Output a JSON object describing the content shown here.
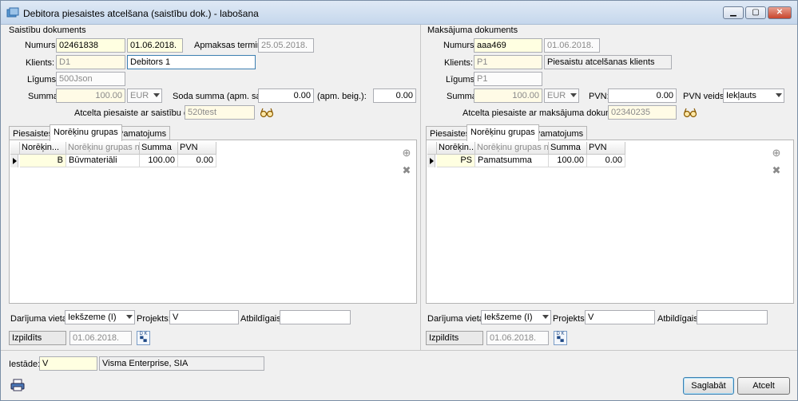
{
  "window": {
    "title": "Debitora piesaistes atcelšana (saistību dok.) - labošana",
    "min_glyph": "▁",
    "max_glyph": "▢",
    "close_glyph": "✕"
  },
  "left": {
    "section_title": "Saistību dokuments",
    "numurs_label": "Numurs:",
    "numurs": "02461838",
    "date": "01.06.2018.",
    "apmaksas_label": "Apmaksas termiņš:",
    "apmaksas": "25.05.2018.",
    "klients_label": "Klients:",
    "klients_code": "D1",
    "klients_name": "Debitors 1",
    "ligums_label": "Līgums:",
    "ligums": "500Json",
    "summa_label": "Summa:",
    "summa": "100.00",
    "currency": "EUR",
    "soda_label": "Soda summa (apm. sak.):",
    "soda_sak": "0.00",
    "beig_label": "(apm. beig.):",
    "soda_beig": "0.00",
    "atcelta_label": "Atcelta piesaiste ar saistību dokumentu:",
    "atcelta": "520test",
    "tabs": [
      "Piesaistes",
      "Norēķinu grupas",
      "Pamatojums"
    ],
    "grid_headers": [
      "Norēķin...",
      "Norēķinu grupas n...",
      "Summa",
      "PVN"
    ],
    "grid_rows": [
      {
        "code": "B",
        "name": "Būvmateriāli",
        "summa": "100.00",
        "pvn": "0.00"
      }
    ],
    "darijuma_label": "Darījuma vieta:",
    "darijuma": "Iekšzeme (I)",
    "projekts_label": "Projekts:",
    "projekts": "V",
    "atbildigais_label": "Atbildīgais:",
    "atbildigais": "",
    "izpildits_label": "Izpildīts",
    "izpildits_date": "01.06.2018."
  },
  "right": {
    "section_title": "Maksājuma dokuments",
    "numurs_label": "Numurs:",
    "numurs": "aaa469",
    "date": "01.06.2018.",
    "klients_label": "Klients:",
    "klients_code": "P1",
    "klients_name": "Piesaistu atcelšanas klients",
    "ligums_label": "Līgums:",
    "ligums": "P1",
    "summa_label": "Summa:",
    "summa": "100.00",
    "currency": "EUR",
    "pvn_label": "PVN:",
    "pvn": "0.00",
    "pvn_veids_label": "PVN veids:",
    "pvn_veids": "Iekļauts",
    "atcelta_label": "Atcelta piesaiste ar maksājuma dokumentu:",
    "atcelta": "02340235",
    "tabs": [
      "Piesaistes",
      "Norēķinu grupas",
      "Pamatojums"
    ],
    "grid_headers": [
      "Norēķin...",
      "Norēķinu grupas n...",
      "Summa",
      "PVN"
    ],
    "grid_rows": [
      {
        "code": "PS",
        "name": "Pamatsumma",
        "summa": "100.00",
        "pvn": "0.00"
      }
    ],
    "darijuma_label": "Darījuma vieta:",
    "darijuma": "Iekšzeme (I)",
    "projekts_label": "Projekts:",
    "projekts": "V",
    "atbildigais_label": "Atbildīgais:",
    "atbildigais": "",
    "izpildits_label": "Izpildīts",
    "izpildits_date": "01.06.2018."
  },
  "footer": {
    "iestade_label": "Iestāde:",
    "iestade_code": "V",
    "iestade_name": "Visma Enterprise, SIA",
    "save_label": "Saglabāt",
    "cancel_label": "Atcelt",
    "dk_glyph": "D K"
  }
}
